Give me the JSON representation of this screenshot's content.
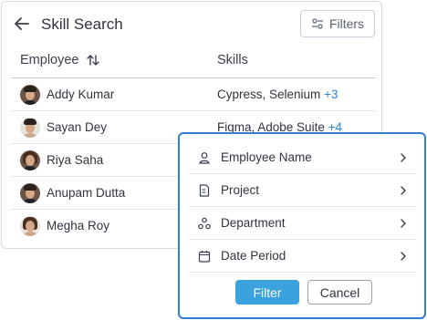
{
  "header": {
    "title": "Skill Search",
    "filters_label": "Filters"
  },
  "table": {
    "columns": [
      "Employee",
      "Skills"
    ],
    "rows": [
      {
        "name": "Addy Kumar",
        "skills": "Cypress, Selenium",
        "more": "+3"
      },
      {
        "name": "Sayan Dey",
        "skills": "Figma, Adobe Suite",
        "more": "+4"
      },
      {
        "name": "Riya Saha",
        "skills": "",
        "more": ""
      },
      {
        "name": "Anupam Dutta",
        "skills": "",
        "more": ""
      },
      {
        "name": "Megha Roy",
        "skills": "",
        "more": ""
      }
    ]
  },
  "filter_menu": {
    "items": [
      {
        "label": "Employee Name",
        "icon": "person-icon"
      },
      {
        "label": "Project",
        "icon": "document-icon"
      },
      {
        "label": "Department",
        "icon": "department-icon"
      },
      {
        "label": "Date Period",
        "icon": "calendar-icon"
      }
    ],
    "filter_label": "Filter",
    "cancel_label": "Cancel"
  },
  "colors": {
    "accent": "#2f7fd4",
    "primary_button": "#3aa3de",
    "link": "#2a86d0"
  }
}
